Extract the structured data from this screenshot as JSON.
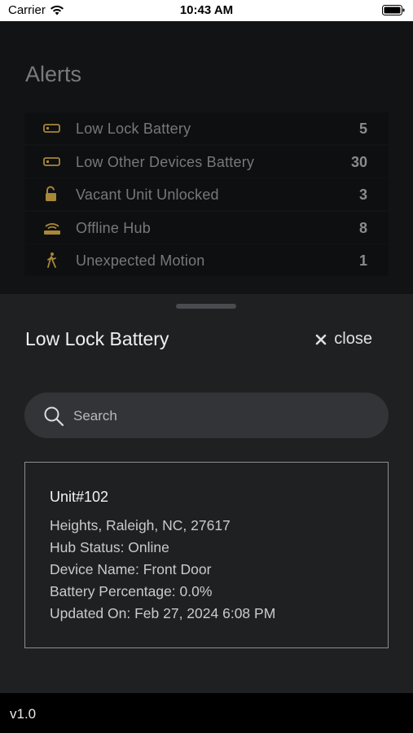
{
  "status_bar": {
    "carrier": "Carrier",
    "time": "10:43 AM"
  },
  "page": {
    "title": "Alerts"
  },
  "alerts": [
    {
      "label": "Low Lock Battery",
      "count": "5",
      "icon": "battery-icon"
    },
    {
      "label": "Low Other Devices Battery",
      "count": "30",
      "icon": "battery-icon"
    },
    {
      "label": "Vacant Unit Unlocked",
      "count": "3",
      "icon": "unlocked-icon"
    },
    {
      "label": "Offline Hub",
      "count": "8",
      "icon": "hub-icon"
    },
    {
      "label": "Unexpected Motion",
      "count": "1",
      "icon": "walking-person-icon"
    }
  ],
  "sheet": {
    "title": "Low Lock Battery",
    "close_label": "close",
    "search_placeholder": "Search",
    "card": {
      "unit": "Unit#102",
      "address": "Heights, Raleigh, NC, 27617",
      "hub_status": "Hub Status: Online",
      "device_name": "Device Name: Front Door",
      "battery": "Battery Percentage: 0.0%",
      "updated": "Updated On: Feb 27, 2024 6:08 PM"
    }
  },
  "footer": {
    "version": "v1.0"
  },
  "colors": {
    "accent_gold": "#a8863a",
    "sheet_bg": "#1f2022",
    "background": "#121314"
  }
}
